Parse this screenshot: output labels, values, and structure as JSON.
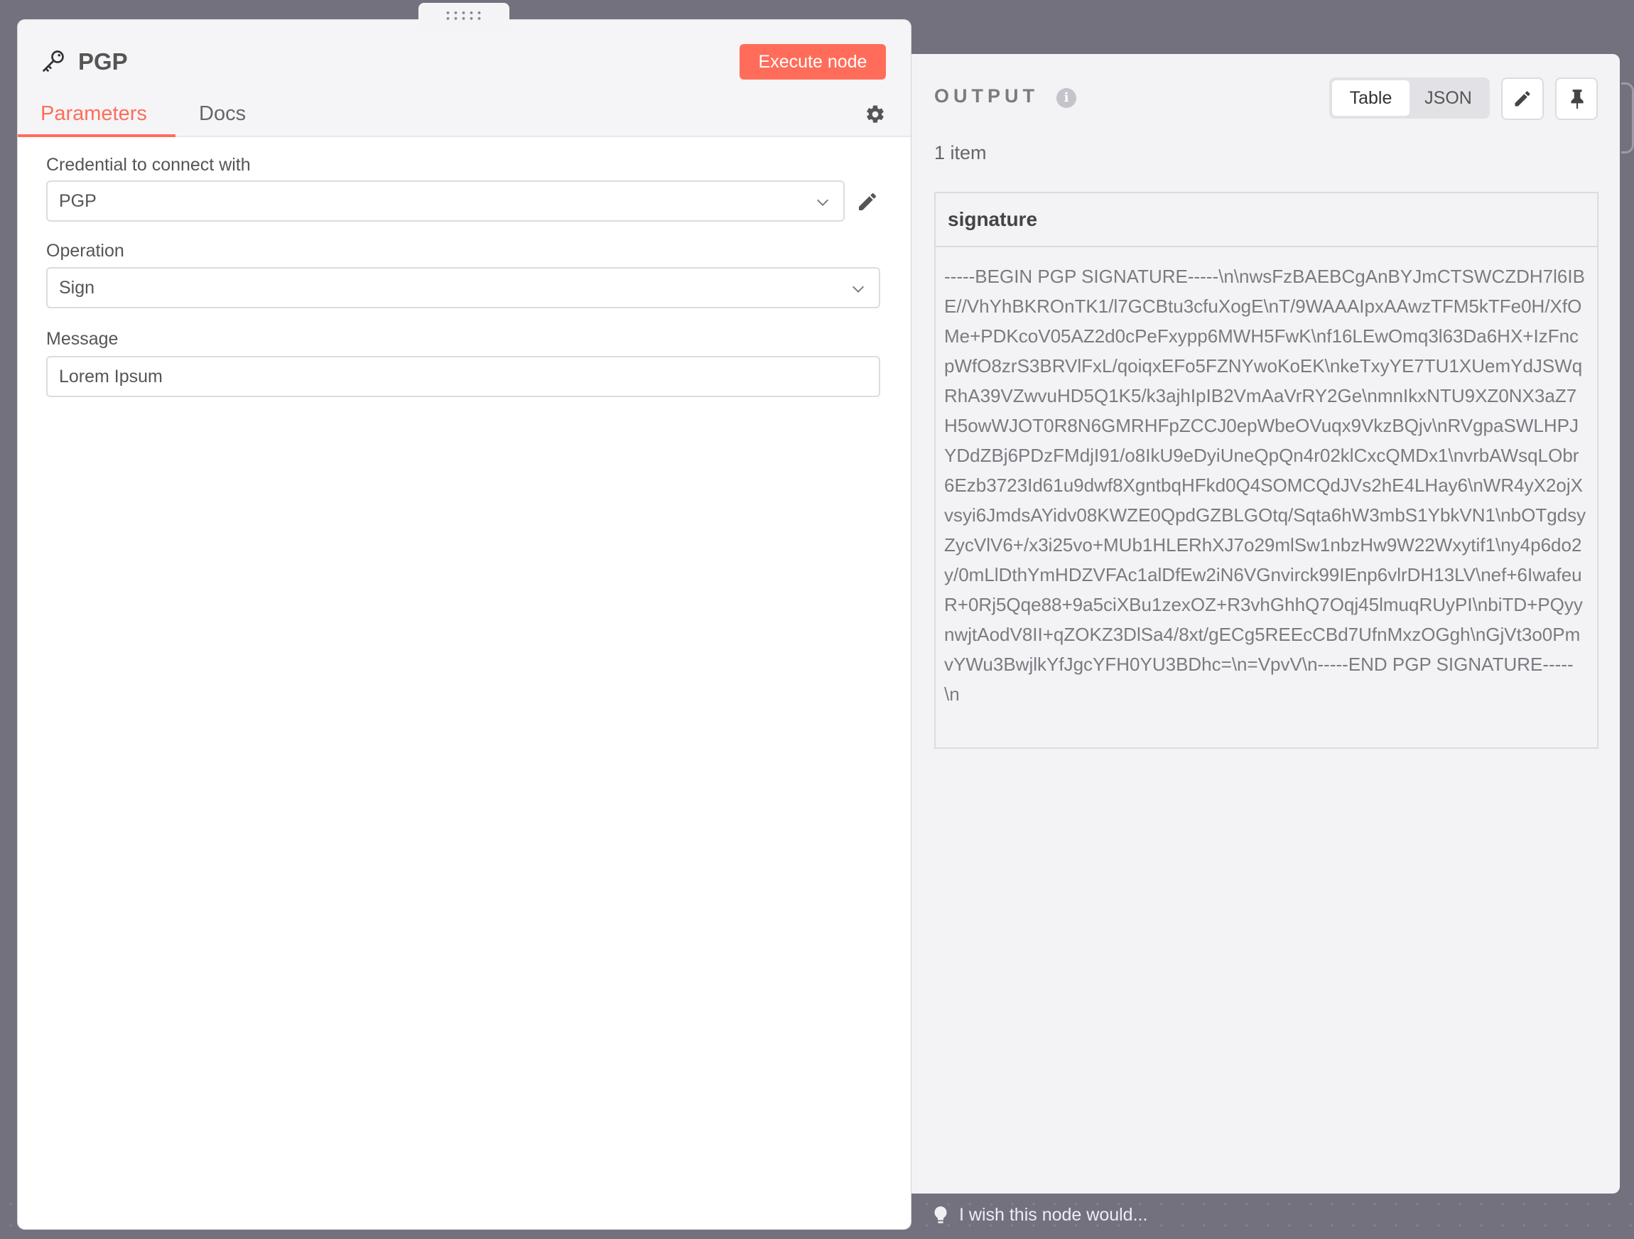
{
  "node": {
    "title": "PGP",
    "execute_label": "Execute node",
    "tabs": [
      {
        "label": "Parameters",
        "active": true
      },
      {
        "label": "Docs",
        "active": false
      }
    ]
  },
  "parameters": {
    "credential": {
      "label": "Credential to connect with",
      "value": "PGP"
    },
    "operation": {
      "label": "Operation",
      "value": "Sign"
    },
    "message": {
      "label": "Message",
      "value": "Lorem Ipsum"
    }
  },
  "output": {
    "title": "OUTPUT",
    "view_options": [
      "Table",
      "JSON"
    ],
    "active_view": "Table",
    "item_count": "1 item",
    "table": {
      "columns": [
        "signature"
      ],
      "rows": [
        [
          "-----BEGIN PGP SIGNATURE-----\\n\\nwsFzBAEBCgAnBYJmCTSWCZDH7l6IBE//VhYhBKROnTK1/l7GCBtu3cfuXogE\\nT/9WAAAIpxAAwzTFM5kTFe0H/XfOMe+PDKcoV05AZ2d0cPeFxypp6MWH5FwK\\nf16LEwOmq3l63Da6HX+IzFncpWfO8zrS3BRVlFxL/qoiqxEFo5FZNYwoKoEK\\nkeTxyYE7TU1XUemYdJSWqRhA39VZwvuHD5Q1K5/k3ajhIpIB2VmAaVrRY2Ge\\nmnIkxNTU9XZ0NX3aZ7H5owWJOT0R8N6GMRHFpZCCJ0epWbeOVuqx9VkzBQjv\\nRVgpaSWLHPJYDdZBj6PDzFMdjI91/o8IkU9eDyiUneQpQn4r02klCxcQMDx1\\nvrbAWsqLObr6Ezb3723Id61u9dwf8XgntbqHFkd0Q4SOMCQdJVs2hE4LHay6\\nWR4yX2ojXvsyi6JmdsAYidv08KWZE0QpdGZBLGOtq/Sqta6hW3mbS1YbkVN1\\nbOTgdsyZycVlV6+/x3i25vo+MUb1HLERhXJ7o29mlSw1nbzHw9W22Wxytif1\\ny4p6do2y/0mLlDthYmHDZVFAc1alDfEw2iN6VGnvirck99IEnp6vlrDH13LV\\nef+6IwafeuR+0Rj5Qqe88+9a5ciXBu1zexOZ+R3vhGhhQ7Oqj45lmuqRUyPI\\nbiTD+PQyynwjtAodV8II+qZOKZ3DlSa4/8xt/gECg5REEcCBd7UfnMxzOGgh\\nGjVt3o0PmvYWu3BwjlkYfJgcYFH0YU3BDhc=\\n=VpvV\\n-----END PGP SIGNATURE-----\\n"
        ]
      ]
    }
  },
  "hint": {
    "text": "I wish this node would..."
  },
  "colors": {
    "accent": "#ff6d5a",
    "backdrop": "#74717f",
    "panel": "#f3f3f6"
  }
}
